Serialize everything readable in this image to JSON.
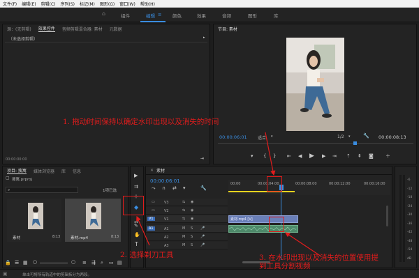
{
  "menu": [
    "文件(F)",
    "编辑(E)",
    "剪辑(C)",
    "序列(S)",
    "标记(M)",
    "图形(G)",
    "窗口(W)",
    "帮助(H)"
  ],
  "workspaces": [
    "组件",
    "编辑",
    "颜色",
    "效果",
    "音频",
    "图形",
    "库"
  ],
  "workspace_active": "编辑",
  "source_panel": {
    "tabs": [
      "源：(无剪辑)",
      "效果控件",
      "音频剪辑混合器: 素材",
      "元数据"
    ],
    "active_tab": "效果控件",
    "no_clip": "（未选择剪辑）",
    "timecode": "00:00:00:00"
  },
  "program_panel": {
    "title": "节目: 素材",
    "timecode": "00:00:06:01",
    "fit": "适合",
    "fraction": "1/2",
    "duration": "00:00:08:13"
  },
  "project_panel": {
    "tabs": [
      "项目: 搜寓",
      "媒体浏览器",
      "库",
      "信息"
    ],
    "project_file": "搜寓.prproj",
    "search_placeholder": "",
    "item_count": "1项已选",
    "items": [
      {
        "name": "素材",
        "duration": "8:13"
      },
      {
        "name": "素材.mp4",
        "duration": "8:13"
      }
    ]
  },
  "timeline": {
    "title": "素材",
    "timecode": "00:00:06:01",
    "ruler": [
      "00:00",
      "00:00:04:00",
      "00:00:08:00",
      "00:00:12:00",
      "00:00:16:00"
    ],
    "tracks": [
      "V3",
      "V2",
      "V1",
      "A1",
      "A2",
      "A3"
    ],
    "clip_label": "素材.mp4 [V]"
  },
  "audio_meter": {
    "labels": [
      "-6",
      "-12",
      "-18",
      "-24",
      "-30",
      "-36",
      "-42",
      "-48",
      "-54",
      "dB"
    ]
  },
  "status_text": "单击可将所有轨道中的剪辑拆分为两段。",
  "annotations": {
    "step1": "1. 拖动时间保持以确定水印出现以及消失的时间",
    "step2": "2. 选择剃刀工具",
    "step3": "3. 在水印出现以及消失的位置使用提\n到工具分割视频"
  },
  "colors": {
    "accent": "#3a8de0",
    "annotation": "#e31c1c",
    "playhead_yellow": "#e6d21e",
    "clip_video": "#6a7fb8",
    "clip_audio": "#4e8a6a"
  }
}
